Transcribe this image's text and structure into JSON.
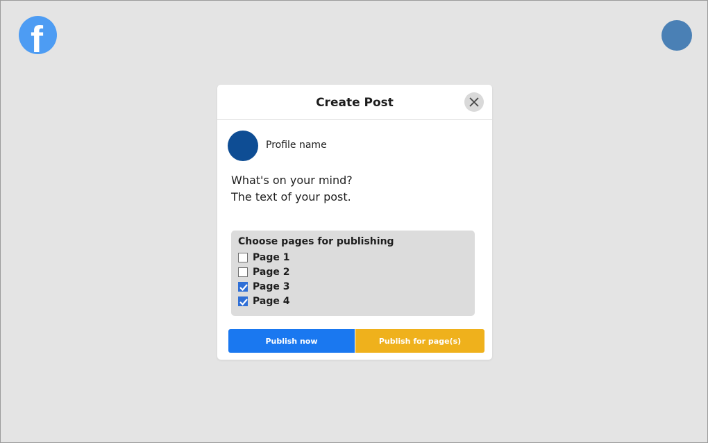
{
  "header": {
    "logo_icon": "facebook-icon",
    "logo_glyph": "f",
    "avatar_color": "#4a80b5"
  },
  "modal": {
    "title": "Create Post",
    "close_icon": "close-icon",
    "profile": {
      "name": "Profile name",
      "avatar_color": "#0e4d94"
    },
    "post_text": {
      "line1": "What's on your mind?",
      "line2": "The text of your post."
    },
    "pages": {
      "title": "Choose pages for publishing",
      "options": [
        {
          "label": "Page 1",
          "checked": false
        },
        {
          "label": "Page 2",
          "checked": false
        },
        {
          "label": "Page 3",
          "checked": true
        },
        {
          "label": "Page 4",
          "checked": true
        }
      ]
    },
    "buttons": {
      "publish_now": "Publish now",
      "publish_pages": "Publish for page(s)"
    }
  },
  "colors": {
    "background": "#e4e4e4",
    "facebook_blue": "#4d9cf3",
    "primary_button": "#1a78f0",
    "secondary_button": "#efb11c",
    "checkbox_checked": "#2f6fd6"
  }
}
